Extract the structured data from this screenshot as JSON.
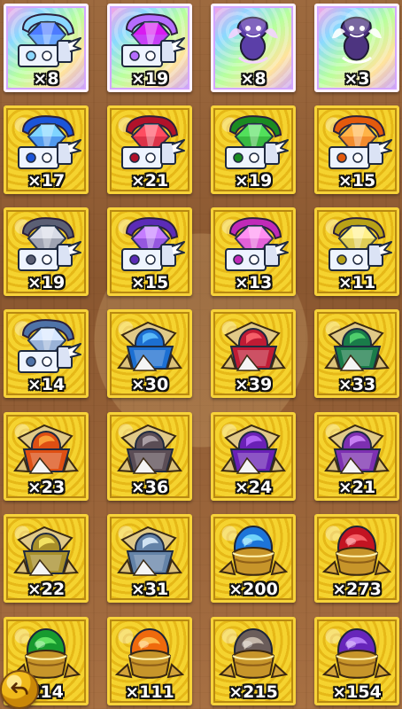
{
  "screen": {
    "title": "",
    "back_button_icon": "undo-arrow-icon"
  },
  "inventory": {
    "items": [
      {
        "type": "chest",
        "quantity": "×8",
        "frame": "rainbow",
        "color": "#8ad7ff",
        "accent": "#4d7bff"
      },
      {
        "type": "chest",
        "quantity": "×19",
        "frame": "rainbow",
        "color": "#b56dff",
        "accent": "#d81bf0"
      },
      {
        "type": "dragon",
        "quantity": "×8",
        "frame": "rainbow",
        "color": "#5b3fa8",
        "accent": "#f4d4ff"
      },
      {
        "type": "dragon",
        "quantity": "×3",
        "frame": "rainbow",
        "color": "#4d3480",
        "accent": "#ffffff"
      },
      {
        "type": "chest",
        "quantity": "×17",
        "frame": "gold",
        "color": "#1b55d9",
        "accent": "#7fd4ff"
      },
      {
        "type": "chest",
        "quantity": "×21",
        "frame": "gold",
        "color": "#b1122a",
        "accent": "#ff4d61"
      },
      {
        "type": "chest",
        "quantity": "×19",
        "frame": "gold",
        "color": "#1b8b22",
        "accent": "#52e05b"
      },
      {
        "type": "chest",
        "quantity": "×15",
        "frame": "gold",
        "color": "#e35a0d",
        "accent": "#ffb347"
      },
      {
        "type": "chest",
        "quantity": "×19",
        "frame": "gold",
        "color": "#5b5f74",
        "accent": "#d8dbe6"
      },
      {
        "type": "chest",
        "quantity": "×15",
        "frame": "gold",
        "color": "#5b2bb7",
        "accent": "#c57dff"
      },
      {
        "type": "chest",
        "quantity": "×13",
        "frame": "gold",
        "color": "#c02ab8",
        "accent": "#ff8ff2"
      },
      {
        "type": "chest",
        "quantity": "×11",
        "frame": "gold",
        "color": "#b8a217",
        "accent": "#fff08a"
      },
      {
        "type": "chest",
        "quantity": "×14",
        "frame": "gold",
        "color": "#4f73a8",
        "accent": "#d7e7ff"
      },
      {
        "type": "crystal-box",
        "quantity": "×30",
        "frame": "gold",
        "color": "#1c6fd2",
        "accent": "#67c7ff"
      },
      {
        "type": "crystal-box",
        "quantity": "×39",
        "frame": "gold",
        "color": "#c01b34",
        "accent": "#ff6a72"
      },
      {
        "type": "crystal-box",
        "quantity": "×33",
        "frame": "gold",
        "color": "#197c49",
        "accent": "#59dc72"
      },
      {
        "type": "crystal-box",
        "quantity": "×23",
        "frame": "gold",
        "color": "#de4f13",
        "accent": "#ffad3f"
      },
      {
        "type": "crystal-box",
        "quantity": "×36",
        "frame": "gold",
        "color": "#5b4d55",
        "accent": "#b9adb3"
      },
      {
        "type": "crystal-box",
        "quantity": "×24",
        "frame": "gold",
        "color": "#6a20b6",
        "accent": "#bb6dff"
      },
      {
        "type": "crystal-box",
        "quantity": "×21",
        "frame": "gold",
        "color": "#7d2fb1",
        "accent": "#d28cff"
      },
      {
        "type": "crystal-box",
        "quantity": "×22",
        "frame": "gold",
        "color": "#a88f2a",
        "accent": "#fff06c"
      },
      {
        "type": "crystal-box",
        "quantity": "×31",
        "frame": "gold",
        "color": "#6483a8",
        "accent": "#e3f3ff"
      },
      {
        "type": "egg",
        "quantity": "×200",
        "frame": "gold",
        "color": "#1d74d8",
        "accent": "#7fe4ff"
      },
      {
        "type": "egg",
        "quantity": "×273",
        "frame": "gold",
        "color": "#c31422",
        "accent": "#ff6d72"
      },
      {
        "type": "egg",
        "quantity": "214",
        "frame": "gold",
        "color": "#179b2f",
        "accent": "#71f06d"
      },
      {
        "type": "egg",
        "quantity": "×111",
        "frame": "gold",
        "color": "#ef6a0d",
        "accent": "#ffc95a"
      },
      {
        "type": "egg",
        "quantity": "×215",
        "frame": "gold",
        "color": "#6b5d5a",
        "accent": "#d5c7b8"
      },
      {
        "type": "egg",
        "quantity": "×154",
        "frame": "gold",
        "color": "#6725bb",
        "accent": "#c088ff"
      }
    ]
  }
}
